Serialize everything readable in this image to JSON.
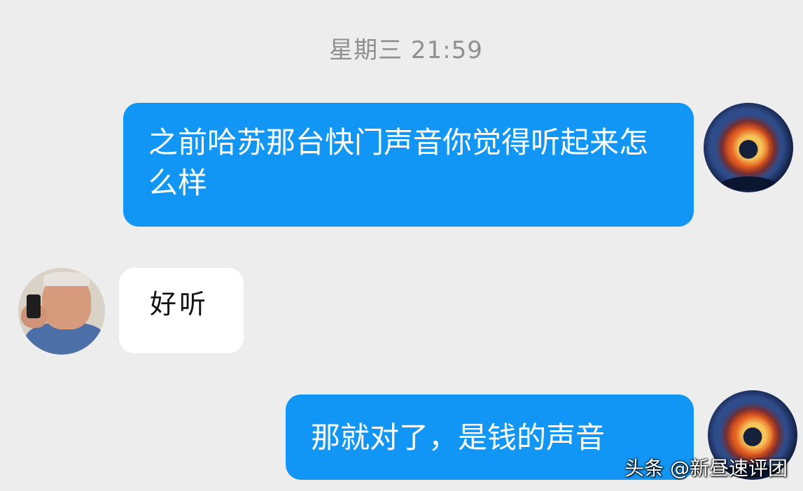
{
  "timestamp": "星期三 21:59",
  "messages": [
    {
      "sender": "me",
      "text": "之前哈苏那台快门声音你觉得听起来怎么样"
    },
    {
      "sender": "other",
      "text": "好听"
    },
    {
      "sender": "me",
      "text": "那就对了，是钱的声音"
    }
  ],
  "watermark": "头条 @新昼速评团",
  "colors": {
    "background": "#ededed",
    "outgoing_bubble": "#1296f5",
    "incoming_bubble": "#ffffff",
    "timestamp_text": "#8f8f8f"
  }
}
